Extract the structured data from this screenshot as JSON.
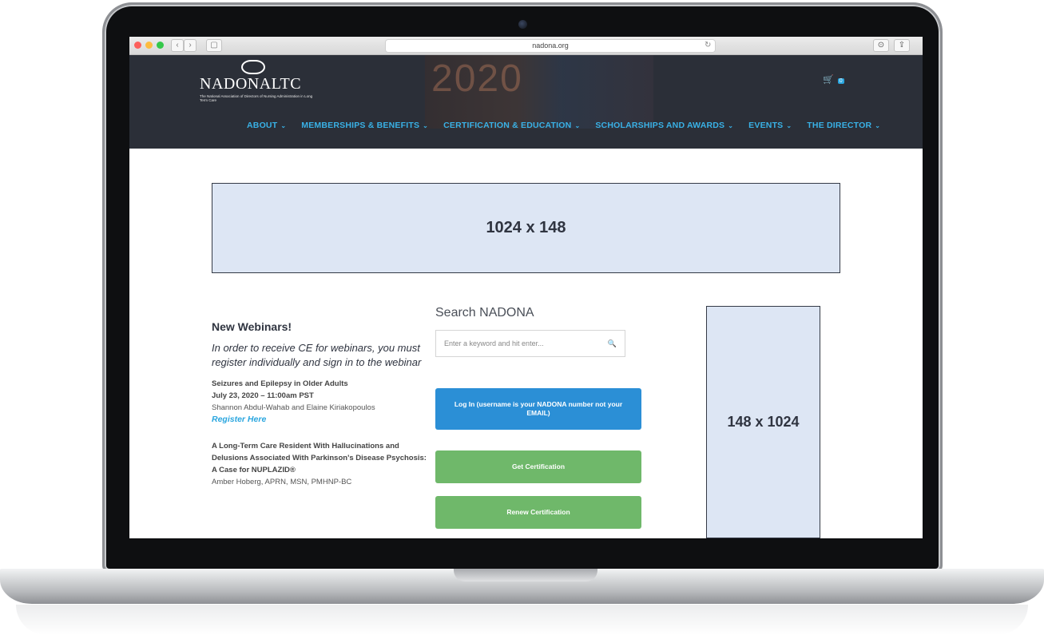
{
  "browser": {
    "url": "nadona.org",
    "back_icon": "‹",
    "forward_icon": "›",
    "sidebar_icon": "▢",
    "reload_icon": "↻",
    "download_icon": "⊙",
    "share_icon": "⇪"
  },
  "header": {
    "logo_name_main": "NADONA",
    "logo_name_suffix": "LTC",
    "logo_tagline": "The National Association of Directors of Nursing Administration in Long Term Care",
    "banner_text": "2020",
    "cart_icon": "🛒",
    "cart_count": "0",
    "nav": [
      {
        "label": "ABOUT"
      },
      {
        "label": "MEMBERSHIPS & BENEFITS"
      },
      {
        "label": "CERTIFICATION & EDUCATION"
      },
      {
        "label": "SCHOLARSHIPS AND AWARDS"
      },
      {
        "label": "EVENTS"
      },
      {
        "label": "THE DIRECTOR"
      }
    ],
    "chevron": "⌄"
  },
  "ads": {
    "top_label": "1024 x 148",
    "side_label": "148 x 1024"
  },
  "webinars": {
    "heading": "New Webinars!",
    "intro": "In order to receive CE for webinars, you must register individually and sign in to the webinar",
    "items": [
      {
        "title": "Seizures and Epilepsy in Older Adults",
        "date": "July 23, 2020 – 11:00am PST",
        "presenters": "Shannon Abdul-Wahab and Elaine Kiriakopoulos",
        "link": "Register Here"
      },
      {
        "title": "A Long-Term Care Resident With Hallucinations and Delusions Associated With Parkinson's Disease Psychosis: A Case for NUPLAZID®",
        "presenters": "Amber Hoberg, APRN, MSN, PMHNP-BC"
      }
    ]
  },
  "search": {
    "title": "Search NADONA",
    "placeholder": "Enter a keyword and hit enter...",
    "icon": "🔍"
  },
  "buttons": {
    "login": "Log In (username is your NADONA number not your EMAIL)",
    "get_cert": "Get Certification",
    "renew_cert": "Renew Certification"
  }
}
